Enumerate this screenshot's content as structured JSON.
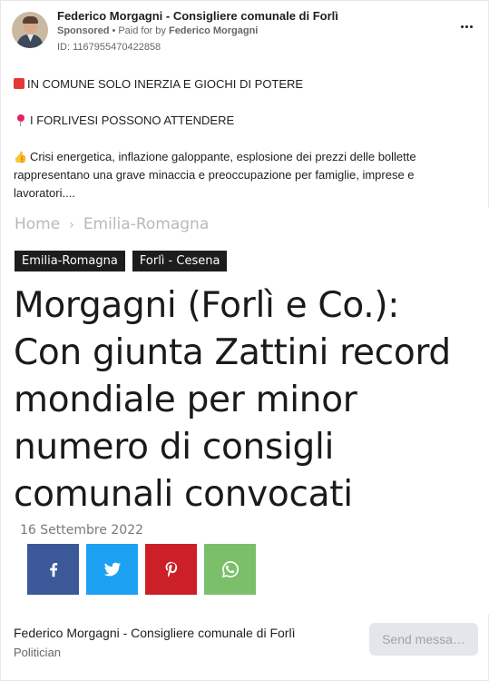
{
  "ad": {
    "page_name": "Federico Morgagni - Consigliere comunale di Forlì",
    "sponsored_label": "Sponsored",
    "dot": "•",
    "paid_for_prefix": "Paid for by",
    "payer": "Federico Morgagni",
    "id_text": "ID: 1167955470422858",
    "more_icon": "more-horizontal-icon"
  },
  "post": {
    "line1": "IN COMUNE SOLO INERZIA E GIOCHI DI POTERE",
    "line2": "I FORLIVESI POSSONO ATTENDERE",
    "line3": "Crisi energetica, inflazione galoppante, esplosione dei prezzi delle bollette rappresentano una grave minaccia e preoccupazione per famiglie, imprese e lavoratori....",
    "icon1": "red-square-icon",
    "icon2": "pushpin-icon",
    "icon3": "thumbs-up-icon"
  },
  "article": {
    "breadcrumb_home": "Home",
    "breadcrumb_sep": "›",
    "breadcrumb_region": "Emilia-Romagna",
    "tags": [
      "Emilia-Romagna",
      "Forlì - Cesena"
    ],
    "headline": "Morgagni (Forlì e Co.): Con giunta Zattini record mondiale per minor numero di consigli comunali convocati",
    "date": "16 Settembre 2022",
    "share_buttons": [
      "facebook-icon",
      "twitter-icon",
      "pinterest-icon",
      "whatsapp-icon"
    ],
    "colors": {
      "facebook": "#3b5998",
      "twitter": "#1da1f2",
      "pinterest": "#cb2027",
      "whatsapp": "#7bbf6a",
      "tag_bg": "#1d1d1d"
    }
  },
  "footer": {
    "page_name": "Federico Morgagni - Consigliere comunale di Forlì",
    "category": "Politician",
    "send_button": "Send messa…"
  }
}
